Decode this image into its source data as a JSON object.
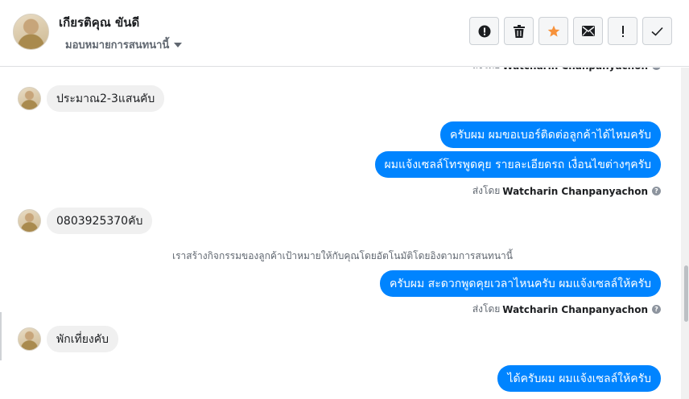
{
  "header": {
    "name": "เกียรติคุณ ขันดี",
    "assign_label": "มอบหมายการสนทนานี้",
    "actions": [
      "spam-button",
      "delete-button",
      "star-button",
      "mark-unread-button",
      "follow-up-button",
      "done-button"
    ]
  },
  "chat": {
    "top_sender": "ส่งโดย Watcharin Chanpanyachon",
    "sender_prefix": "ส่งโดย",
    "sender_name": "Watcharin Chanpanyachon",
    "messages": [
      {
        "direction": "in",
        "text": "ประมาณ2-3แสนคับ"
      },
      {
        "direction": "out",
        "text": "ครับผม ผมขอเบอร์ติดต่อลูกค้าได้ไหมครับ"
      },
      {
        "direction": "out",
        "text": "ผมแจ้งเซลล์โทรพูดคุย รายละเอียดรถ เงื่อนไขต่างๆครับ"
      },
      {
        "direction": "in",
        "text": "0803925370คับ"
      },
      {
        "direction": "system",
        "text": "เราสร้างกิจกรรมของลูกค้าเป้าหมายให้กับคุณโดยอัตโนมัติโดยอิงตามการสนทนานี้"
      },
      {
        "direction": "out",
        "text": "ครับผม สะดวกพูดคุยเวลาไหนครับ ผมแจ้งเซลล์ให้ครับ"
      },
      {
        "direction": "in",
        "text": "พักเที่ยงคับ"
      },
      {
        "direction": "out",
        "text": "ได้ครับผม ผมแจ้งเซลล์ให้ครับ"
      }
    ]
  },
  "colors": {
    "outgoing_bubble": "#0084ff",
    "incoming_bubble": "#f0f0f0",
    "star_accent": "#f7923b"
  }
}
